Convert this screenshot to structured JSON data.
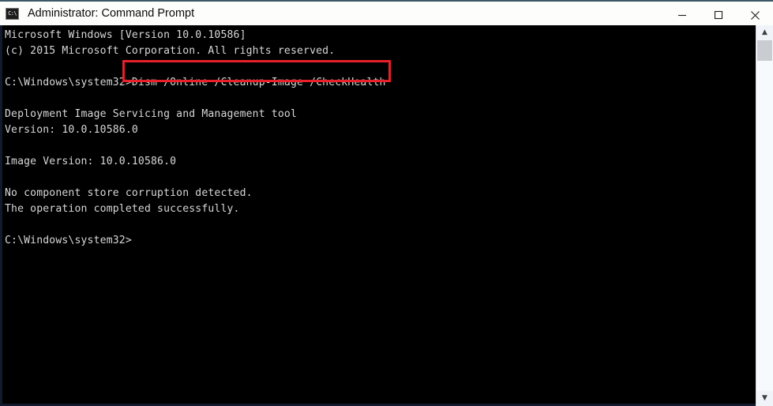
{
  "window": {
    "title": "Administrator: Command Prompt",
    "icon": "cmd-console-icon",
    "icon_glyph": "C:\\",
    "controls": [
      {
        "name": "minimize",
        "glyph": "—"
      },
      {
        "name": "maximize",
        "glyph": "□"
      },
      {
        "name": "close",
        "glyph": "✕"
      }
    ]
  },
  "console": {
    "background_color": "#000000",
    "text_color": "#d8d8d8",
    "content": "Microsoft Windows [Version 10.0.10586]\n(c) 2015 Microsoft Corporation. All rights reserved.\n\nC:\\Windows\\system32>Dism /Online /Cleanup-Image /CheckHealth\n\nDeployment Image Servicing and Management tool\nVersion: 10.0.10586.0\n\nImage Version: 10.0.10586.0\n\nNo component store corruption detected.\nThe operation completed successfully.\n\nC:\\Windows\\system32>",
    "lines": [
      "Microsoft Windows [Version 10.0.10586]",
      "(c) 2015 Microsoft Corporation. All rights reserved.",
      "",
      "C:\\Windows\\system32>Dism /Online /Cleanup-Image /CheckHealth",
      "",
      "Deployment Image Servicing and Management tool",
      "Version: 10.0.10586.0",
      "",
      "Image Version: 10.0.10586.0",
      "",
      "No component store corruption detected.",
      "The operation completed successfully.",
      "",
      "C:\\Windows\\system32>"
    ],
    "prompt": "C:\\Windows\\system32>",
    "command": "Dism /Online /Cleanup-Image /CheckHealth"
  },
  "annotation": {
    "type": "highlight-rectangle",
    "color": "#e8202a",
    "targets_text": "Dism /Online /Cleanup-Image /CheckHealth"
  },
  "scrollbar": {
    "up_arrow": "▲",
    "down_arrow": "▼",
    "orientation": "vertical"
  }
}
